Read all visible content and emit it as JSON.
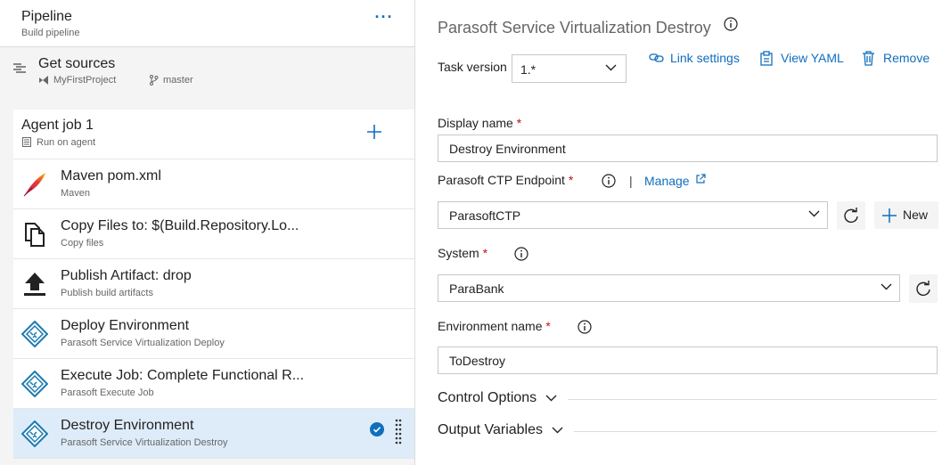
{
  "pipeline": {
    "title": "Pipeline",
    "subtitle": "Build pipeline",
    "more_label": "···"
  },
  "get_sources": {
    "title": "Get sources",
    "repo": "MyFirstProject",
    "branch": "master"
  },
  "agent_job": {
    "title": "Agent job 1",
    "subtitle": "Run on agent"
  },
  "tasks": [
    {
      "title": "Maven pom.xml",
      "subtitle": "Maven",
      "icon": "maven-feather-icon"
    },
    {
      "title": "Copy Files to: $(Build.Repository.Lo...",
      "subtitle": "Copy files",
      "icon": "copy-files-icon"
    },
    {
      "title": "Publish Artifact: drop",
      "subtitle": "Publish build artifacts",
      "icon": "upload-icon"
    },
    {
      "title": "Deploy Environment",
      "subtitle": "Parasoft Service Virtualization Deploy",
      "icon": "parasoft-icon"
    },
    {
      "title": "Execute Job: Complete Functional R...",
      "subtitle": "Parasoft Execute Job",
      "icon": "parasoft-icon"
    },
    {
      "title": "Destroy Environment",
      "subtitle": "Parasoft Service Virtualization Destroy",
      "icon": "parasoft-icon",
      "selected": true
    }
  ],
  "details": {
    "heading": "Parasoft Service Virtualization Destroy",
    "task_version_label": "Task version",
    "task_version_value": "1.*",
    "link_settings": "Link settings",
    "view_yaml": "View YAML",
    "remove": "Remove",
    "display_name_label": "Display name",
    "display_name_value": "Destroy Environment",
    "endpoint_label": "Parasoft CTP Endpoint",
    "separator": "|",
    "manage_label": "Manage",
    "endpoint_value": "ParasoftCTP",
    "new_label": "New",
    "system_label": "System",
    "system_value": "ParaBank",
    "env_name_label": "Environment name",
    "env_name_value": "ToDestroy",
    "required_marker": "*",
    "control_options": "Control Options",
    "output_variables": "Output Variables"
  },
  "colors": {
    "accent": "#106ebe",
    "selected_row": "#deecf9",
    "required": "#c50f1f",
    "parasoft": "#1a7bb0"
  }
}
